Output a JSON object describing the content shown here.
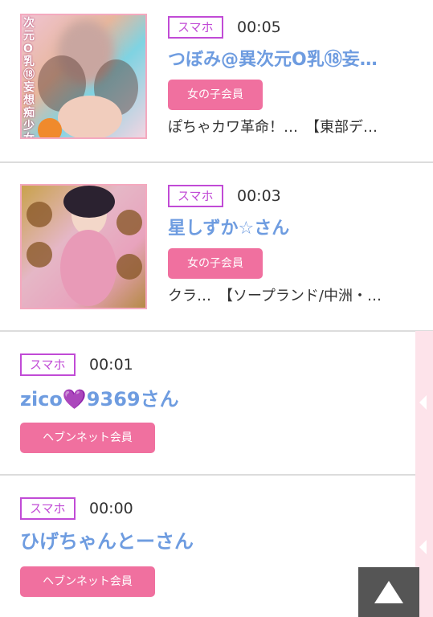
{
  "entries": [
    {
      "device": "スマホ",
      "time": "00:05",
      "name": "つぼみ@異次元O乳⑱妄…",
      "member": "女の子会員",
      "desc": "ぽちゃカワ革命！…　【東部デ…",
      "thumb_text": "次元O乳⑱妄想痴少女"
    },
    {
      "device": "スマホ",
      "time": "00:03",
      "name": "星しずか☆さん",
      "member": "女の子会員",
      "desc": "クラ…　【ソープランド/中洲・…"
    },
    {
      "device": "スマホ",
      "time": "00:01",
      "name": "zico💜9369さん",
      "member": "ヘブンネット会員"
    },
    {
      "device": "スマホ",
      "time": "00:00",
      "name": "ひげちゃんとーさん",
      "member": "ヘブンネット会員"
    }
  ],
  "colors": {
    "device_badge": "#c14bd6",
    "name_text": "#6e9ce0",
    "member_badge": "#f0709f",
    "side_bar": "#fde3ea",
    "to_top": "#555555"
  },
  "icons": {
    "to_top": "up-triangle-icon"
  }
}
